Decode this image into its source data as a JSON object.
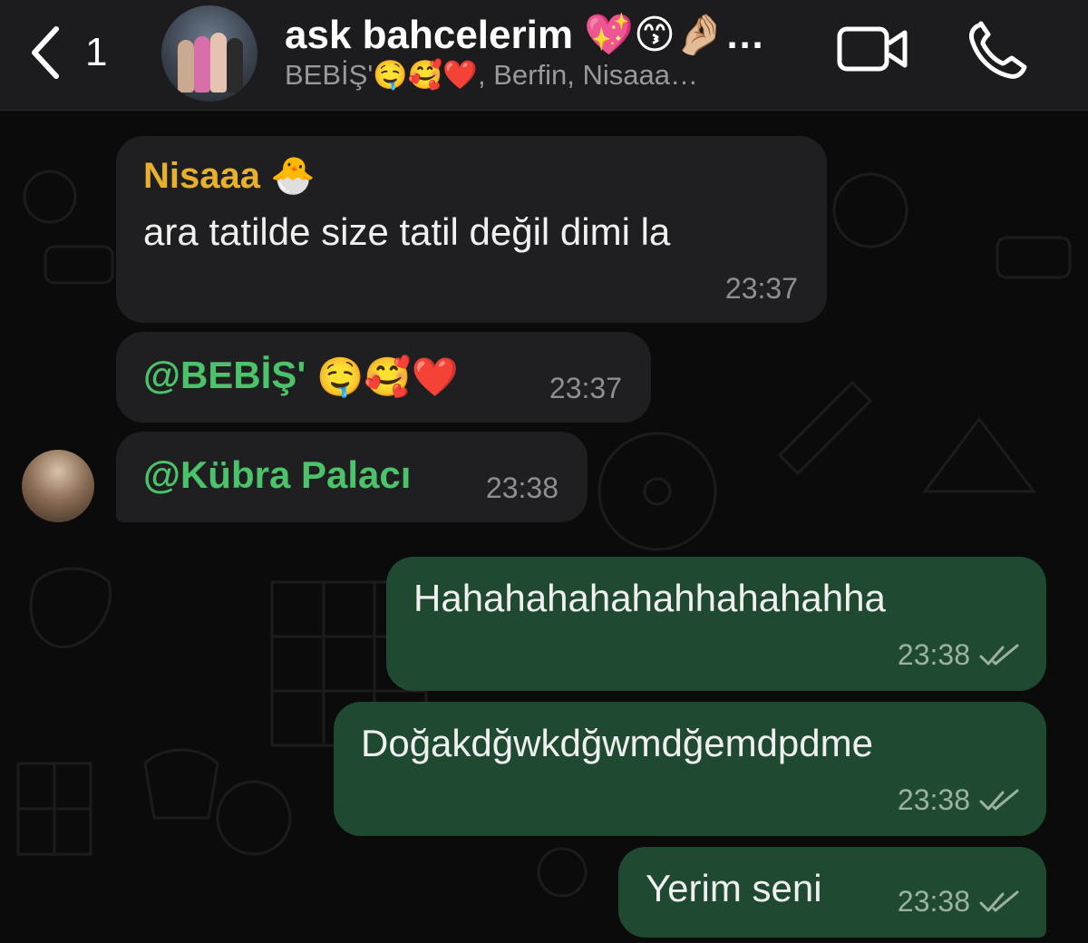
{
  "header": {
    "back_count": "1",
    "group_title": "ask bahcelerim 💖😙🤌🏼…",
    "group_subtitle": "BEBİŞ'🤤🥰❤️, Berfin, Nisaaa…",
    "icons": [
      "chevron-left-icon",
      "video-camera-icon",
      "phone-icon"
    ]
  },
  "messages": [
    {
      "sender": "Nisaaa 🐣",
      "text": "ara tatilde size tatil değil dimi la",
      "time": "23:37"
    },
    {
      "mention": "@BEBİŞ'",
      "emojis": "🤤🥰❤️",
      "time": "23:37"
    },
    {
      "mention": "@Kübra Palacı",
      "time": "23:38"
    },
    {
      "text": "Hahahahahahahhahahahha",
      "time": "23:38"
    },
    {
      "text": "Doğakdğwkdğwmdğemdpdme",
      "time": "23:38"
    },
    {
      "text": "Yerim seni",
      "time": "23:38"
    }
  ],
  "colors": {
    "incoming_bubble": "#1f1f21",
    "outgoing_bubble": "#1f4a31",
    "sender_name": "#e7b12f",
    "mention": "#4cc26a"
  }
}
